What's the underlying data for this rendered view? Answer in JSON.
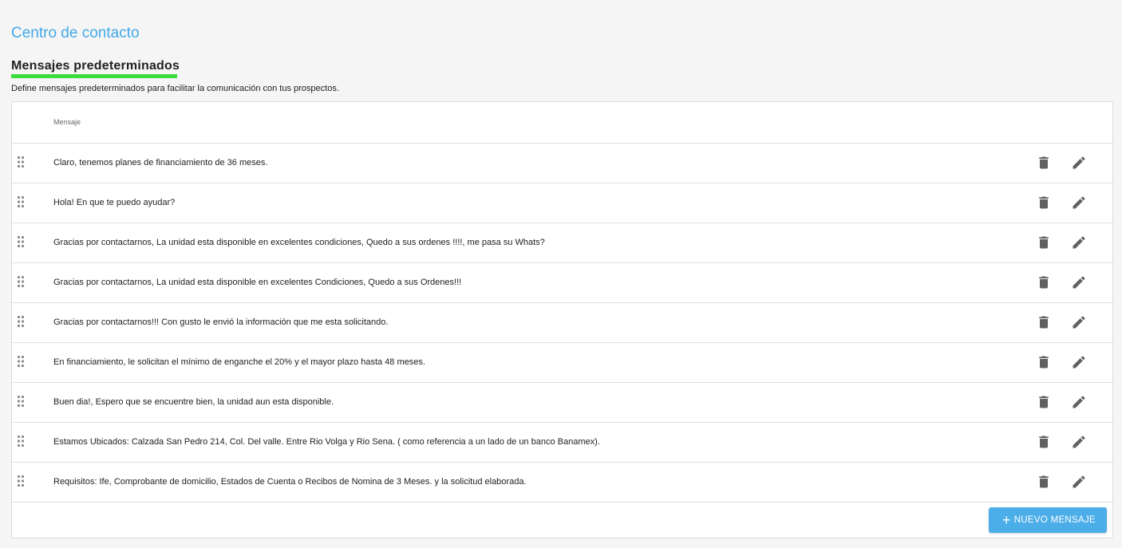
{
  "page": {
    "title": "Centro de contacto"
  },
  "section": {
    "title": "Mensajes predeterminados",
    "description": "Define mensajes predeterminados para facilitar la comunicación con tus prospectos.",
    "accent_color": "#3cdc3c"
  },
  "table": {
    "column_header": "Mensaje",
    "rows": [
      {
        "message": "Claro, tenemos planes de financiamiento de 36 meses."
      },
      {
        "message": "Hola! En que te puedo ayudar?"
      },
      {
        "message": "Gracias por contactarnos, La unidad esta disponible en excelentes condiciones, Quedo a sus ordenes !!!!, me pasa su Whats?"
      },
      {
        "message": "Gracias por contactarnos, La unidad esta disponible en excelentes Condiciones, Quedo a sus Ordenes!!!"
      },
      {
        "message": "Gracias por contactarnos!!! Con gusto le envió la información que me esta solicitando."
      },
      {
        "message": "En financiamiento, le solicitan el mínimo de enganche el 20% y el mayor plazo hasta 48 meses."
      },
      {
        "message": "Buen dia!, Espero que se encuentre bien, la unidad aun esta disponible."
      },
      {
        "message": "Estamos Ubicados: Calzada San Pedro 214, Col. Del valle. Entre Rio Volga y Rio Sena. ( como referencia a un lado de un banco Banamex)."
      },
      {
        "message": "Requisitos: Ife, Comprobante de domicilio, Estados de Cuenta o Recibos de Nomina de 3 Meses. y la solicitud elaborada."
      }
    ],
    "row_icons": [
      "drag-handle-icon",
      "trash-icon",
      "pencil-icon"
    ]
  },
  "actions": {
    "new_message_label": "NUEVO MENSAJE",
    "new_message_icon": "plus-icon",
    "button_color": "#4caee9"
  },
  "colors": {
    "title": "#42a9e8",
    "icon": "#616161"
  }
}
